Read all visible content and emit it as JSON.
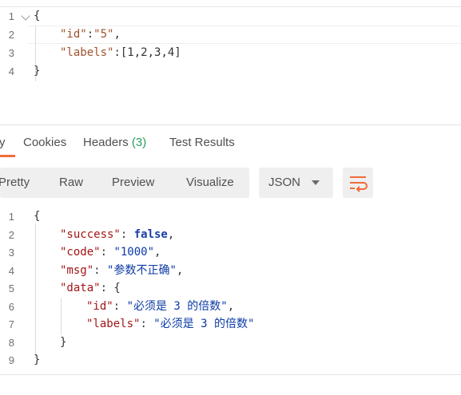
{
  "request_body": {
    "line_numbers": [
      "1",
      "2",
      "3",
      "4"
    ],
    "lines": [
      {
        "t": [
          {
            "c": "p",
            "v": "{"
          }
        ]
      },
      {
        "t": [
          {
            "c": "k",
            "v": "\"id\""
          },
          {
            "c": "p",
            "v": ":"
          },
          {
            "c": "s",
            "v": "\"5\""
          },
          {
            "c": "p",
            "v": ","
          }
        ]
      },
      {
        "t": [
          {
            "c": "k",
            "v": "\"labels\""
          },
          {
            "c": "p",
            "v": ":"
          },
          {
            "c": "p",
            "v": "[1,2,3,4]"
          }
        ]
      },
      {
        "t": [
          {
            "c": "p",
            "v": "}"
          }
        ]
      }
    ]
  },
  "response_tabs": {
    "body_partial": "y",
    "cookies": "Cookies",
    "headers": "Headers",
    "headers_count": "(3)",
    "test_results": "Test Results",
    "accent_color": "#f26b3a"
  },
  "toolbar": {
    "pretty": "Pretty",
    "raw": "Raw",
    "preview": "Preview",
    "visualize": "Visualize",
    "format_select": "JSON",
    "wrap_icon": "wrap-lines-icon"
  },
  "response_body": {
    "line_numbers": [
      "1",
      "2",
      "3",
      "4",
      "5",
      "6",
      "7",
      "8",
      "9"
    ],
    "lines": [
      {
        "indent": 0,
        "t": [
          {
            "c": "p",
            "v": "{"
          }
        ]
      },
      {
        "indent": 1,
        "t": [
          {
            "c": "k",
            "v": "\"success\""
          },
          {
            "c": "p",
            "v": ": "
          },
          {
            "c": "b",
            "v": "false"
          },
          {
            "c": "p",
            "v": ","
          }
        ]
      },
      {
        "indent": 1,
        "t": [
          {
            "c": "k",
            "v": "\"code\""
          },
          {
            "c": "p",
            "v": ": "
          },
          {
            "c": "s",
            "v": "\"1000\""
          },
          {
            "c": "p",
            "v": ","
          }
        ]
      },
      {
        "indent": 1,
        "t": [
          {
            "c": "k",
            "v": "\"msg\""
          },
          {
            "c": "p",
            "v": ": "
          },
          {
            "c": "s",
            "v": "\"参数不正确\""
          },
          {
            "c": "p",
            "v": ","
          }
        ]
      },
      {
        "indent": 1,
        "t": [
          {
            "c": "k",
            "v": "\"data\""
          },
          {
            "c": "p",
            "v": ": {"
          }
        ]
      },
      {
        "indent": 2,
        "t": [
          {
            "c": "k",
            "v": "\"id\""
          },
          {
            "c": "p",
            "v": ": "
          },
          {
            "c": "s",
            "v": "\"必须是 3 的倍数\""
          },
          {
            "c": "p",
            "v": ","
          }
        ]
      },
      {
        "indent": 2,
        "t": [
          {
            "c": "k",
            "v": "\"labels\""
          },
          {
            "c": "p",
            "v": ": "
          },
          {
            "c": "s",
            "v": "\"必须是 3 的倍数\""
          }
        ]
      },
      {
        "indent": 1,
        "t": [
          {
            "c": "p",
            "v": "}"
          }
        ]
      },
      {
        "indent": 0,
        "t": [
          {
            "c": "p",
            "v": "}"
          }
        ]
      }
    ]
  }
}
